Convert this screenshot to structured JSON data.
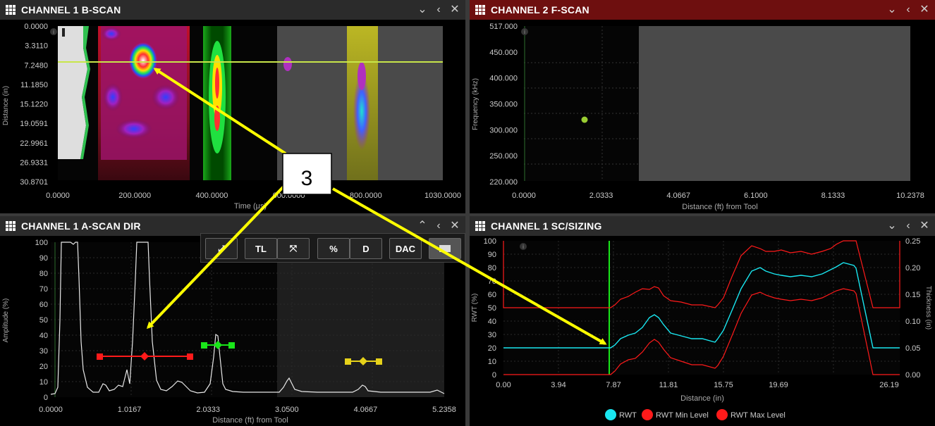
{
  "panels": {
    "bscan": {
      "title": "CHANNEL 1 B-SCAN",
      "ylabel": "Distance (in)",
      "xlabel": "Time (μs)",
      "yticks": [
        "0.0000",
        "3.3110",
        "7.2480",
        "11.1850",
        "15.1220",
        "19.0591",
        "22.9961",
        "26.9331",
        "30.8701"
      ],
      "xticks": [
        "0.0000",
        "200.0000",
        "400.0000",
        "600.0000",
        "800.0000",
        "1030.0000"
      ]
    },
    "fscan": {
      "title": "CHANNEL 2 F-SCAN",
      "ylabel": "Frequency (kHz)",
      "xlabel": "Distance (ft) from Tool",
      "yticks": [
        "517.000",
        "450.000",
        "400.000",
        "350.000",
        "300.000",
        "250.000",
        "220.000"
      ],
      "xticks": [
        "0.0000",
        "2.0333",
        "4.0667",
        "6.1000",
        "8.1333",
        "10.2378"
      ]
    },
    "ascan": {
      "title": "CHANNEL 1 A-SCAN DIR",
      "ylabel": "Amplitude (%)",
      "xlabel": "Distance (ft) from Tool",
      "yticks": [
        "100",
        "90",
        "80",
        "70",
        "60",
        "50",
        "40",
        "30",
        "20",
        "10",
        "0"
      ],
      "xticks": [
        "0.0000",
        "1.0167",
        "2.0333",
        "3.0500",
        "4.0667",
        "5.2358"
      ]
    },
    "sizing": {
      "title": "CHANNEL 1 SC/SIZING",
      "ylabel_left": "RWT (%)",
      "ylabel_right": "Thickness (in)",
      "xlabel": "Distance (in)",
      "yticks_left": [
        "100",
        "90",
        "80",
        "70",
        "60",
        "50",
        "40",
        "30",
        "20",
        "10",
        "0"
      ],
      "yticks_right": [
        "0.25",
        "0.20",
        "0.15",
        "0.10",
        "0.05",
        "0.00"
      ],
      "xticks": [
        "0.00",
        "3.94",
        "7.87",
        "11.81",
        "15.75",
        "19.69",
        "26.19"
      ],
      "legend": [
        {
          "label": "RWT",
          "color": "#19e6f0"
        },
        {
          "label": "RWT Min Level",
          "color": "#ff1a1a"
        },
        {
          "label": "RWT Max Level",
          "color": "#ff1a1a"
        }
      ]
    }
  },
  "toolbar": {
    "tl": "TL",
    "pct": "%",
    "d": "D",
    "dac": "DAC"
  },
  "callout": {
    "label": "3"
  },
  "icons": {
    "panel_menu": "grid-icon",
    "collapse": "chevron-up-icon",
    "minimize": "chevron-down-icon",
    "back": "chevron-left-icon",
    "close": "close-icon",
    "info": "info-icon"
  },
  "colors": {
    "accent_red": "#6e0f0f",
    "rwt": "#19e6f0",
    "limit": "#ff1a1a",
    "arrow": "#ffff00",
    "gate_red": "#ff1a1a",
    "gate_green": "#19e619",
    "gate_yellow": "#e6d21a"
  }
}
